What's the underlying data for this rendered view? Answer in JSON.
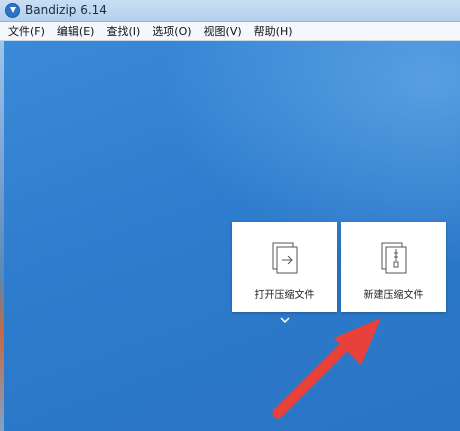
{
  "window": {
    "title": "Bandizip 6.14",
    "icon": "bandizip-icon"
  },
  "menubar": {
    "items": [
      {
        "label": "文件(F)"
      },
      {
        "label": "编辑(E)"
      },
      {
        "label": "查找(I)"
      },
      {
        "label": "选项(O)"
      },
      {
        "label": "视图(V)"
      },
      {
        "label": "帮助(H)"
      }
    ]
  },
  "tiles": {
    "open_archive": {
      "label": "打开压缩文件",
      "icon": "open-archive-icon"
    },
    "new_archive": {
      "label": "新建压缩文件",
      "icon": "new-archive-icon"
    }
  },
  "more_icon": "chevron-down-icon",
  "annotation": {
    "icon": "red-arrow-annotation",
    "color": "#e8413a"
  },
  "colors": {
    "desktop_blue": "#2f7fd0",
    "titlebar": "#c9dff3",
    "tile_bg": "#ffffff"
  }
}
